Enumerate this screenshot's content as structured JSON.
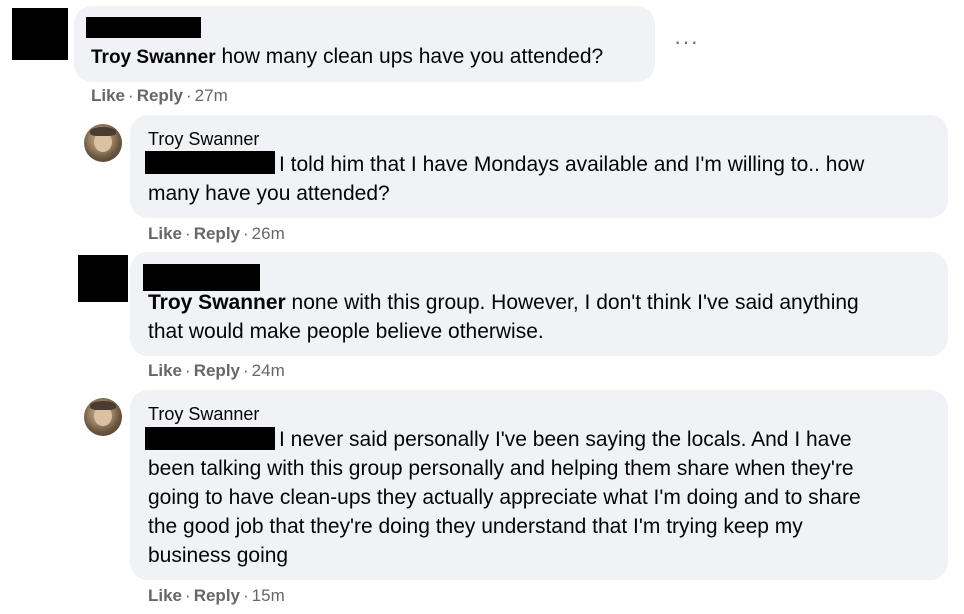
{
  "comments": [
    {
      "author": "",
      "mention": "Troy Swanner",
      "text": " how many clean ups have you attended?",
      "actions": {
        "like": "Like",
        "reply": "Reply",
        "time": "27m"
      },
      "more_icon": "ellipsis-icon",
      "more_label": "···"
    },
    {
      "author": "Troy Swanner",
      "text_line1": "I told him that I have Mondays available and I'm willing to.. how",
      "text_rest": "many have you attended?",
      "actions": {
        "like": "Like",
        "reply": "Reply",
        "time": "26m"
      }
    },
    {
      "author": "",
      "mention": "Troy Swanner",
      "text_line1": " none with this group. However, I don't think I've said anything",
      "text_rest": "that would make people believe otherwise.",
      "actions": {
        "like": "Like",
        "reply": "Reply",
        "time": "24m"
      }
    },
    {
      "author": "Troy Swanner",
      "text_line1": "I never said personally I've been saying the locals. And I have",
      "text_rest": "been talking with this group personally and helping them share when they're\ngoing to have clean-ups they actually appreciate what I'm doing and to share\nthe good job that they're doing they understand that I'm trying keep my\nbusiness going",
      "actions": {
        "like": "Like",
        "reply": "Reply",
        "time": "15m"
      }
    }
  ],
  "separator": " · "
}
